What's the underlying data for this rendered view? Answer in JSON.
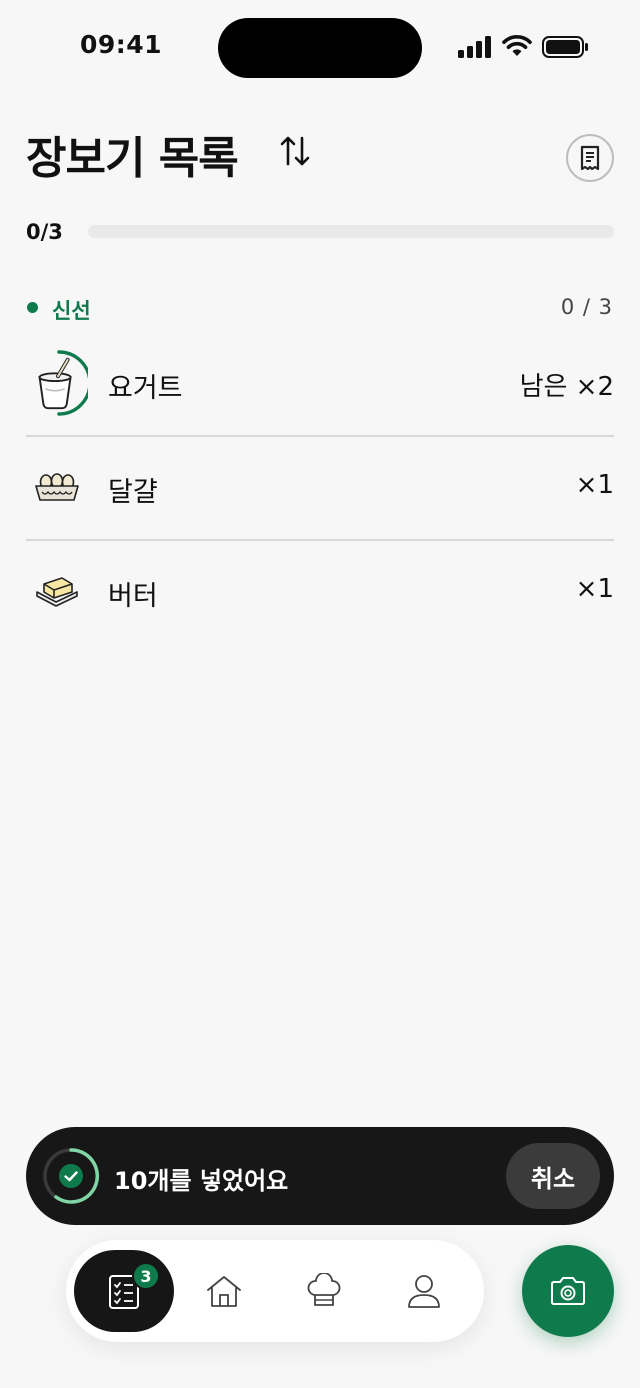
{
  "status_bar": {
    "time": "09:41"
  },
  "header": {
    "title": "장보기 목록"
  },
  "progress": {
    "text": "0/3",
    "fraction": 0
  },
  "section": {
    "title": "신선",
    "count": "0 / 3",
    "accent_color": "#0f7a4b",
    "items": [
      {
        "name": "요거트",
        "quantity": "남은 ×2",
        "icon": "yogurt-icon"
      },
      {
        "name": "달걀",
        "quantity": "×1",
        "icon": "egg-carton-icon"
      },
      {
        "name": "버터",
        "quantity": "×1",
        "icon": "butter-icon"
      }
    ]
  },
  "toast": {
    "message": "10개를 넣었어요",
    "undo_label": "취소"
  },
  "tab_bar": {
    "badge": "3",
    "tabs": [
      {
        "icon": "checklist-icon",
        "active": true
      },
      {
        "icon": "home-icon",
        "active": false
      },
      {
        "icon": "chef-hat-icon",
        "active": false
      },
      {
        "icon": "user-icon",
        "active": false
      }
    ]
  },
  "fab": {
    "icon": "camera-icon"
  }
}
